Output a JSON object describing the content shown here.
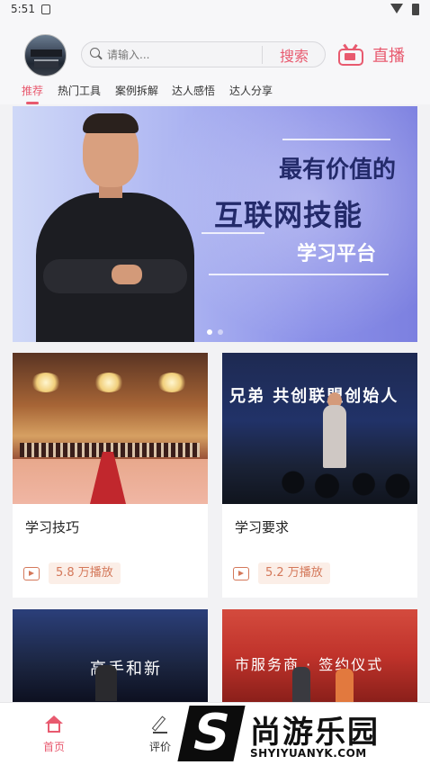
{
  "status_bar": {
    "time": "5:51"
  },
  "header": {
    "search": {
      "placeholder": "请输入...",
      "button_label": "搜索"
    },
    "live_label": "直播"
  },
  "tabs": [
    {
      "label": "推荐",
      "active": true
    },
    {
      "label": "热门工具",
      "active": false
    },
    {
      "label": "案例拆解",
      "active": false
    },
    {
      "label": "达人感悟",
      "active": false
    },
    {
      "label": "达人分享",
      "active": false
    }
  ],
  "banner": {
    "line1": "最有价值的",
    "line2": "互联网技能",
    "line3": "学习平台",
    "page_count": 2,
    "current_page": 1
  },
  "cards": [
    {
      "title": "学习技巧",
      "plays": "5.8 万播放",
      "thumb_text": ""
    },
    {
      "title": "学习要求",
      "plays": "5.2 万播放",
      "thumb_text": "兄弟 共创联盟创始人"
    },
    {
      "title": "",
      "plays": "",
      "thumb_text": "高手和新"
    },
    {
      "title": "",
      "plays": "",
      "thumb_text": "市服务商 · 签约仪式"
    }
  ],
  "bottom_nav": [
    {
      "label": "首页",
      "active": true
    },
    {
      "label": "评价",
      "active": false
    }
  ],
  "watermark": {
    "mark": "S",
    "name": "尚游乐园",
    "url": "SHYIYUANYK.COM"
  },
  "colors": {
    "accent": "#e85a6f",
    "play_count": "#d4785a",
    "banner_title": "#232a6a"
  }
}
